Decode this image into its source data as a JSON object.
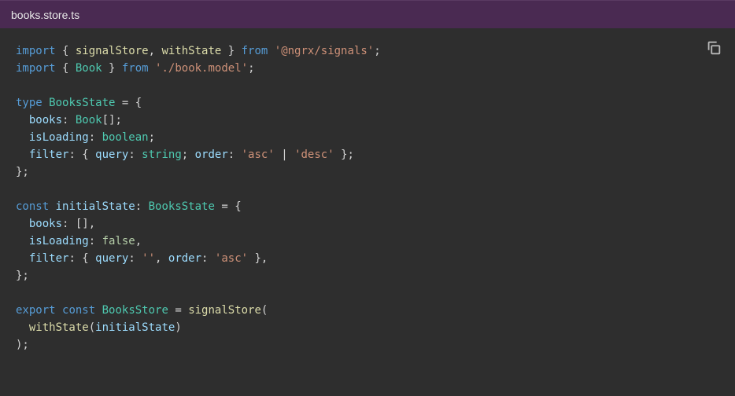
{
  "file": {
    "name": "books.store.ts"
  },
  "copy": {
    "label": "Copy"
  },
  "code": {
    "tokens": [
      [
        [
          "key",
          "import"
        ],
        [
          "punc",
          " { "
        ],
        [
          "fn",
          "signalStore"
        ],
        [
          "punc",
          ", "
        ],
        [
          "fn",
          "withState"
        ],
        [
          "punc",
          " } "
        ],
        [
          "key",
          "from"
        ],
        [
          "punc",
          " "
        ],
        [
          "str",
          "'@ngrx/signals'"
        ],
        [
          "punc",
          ";"
        ]
      ],
      [
        [
          "key",
          "import"
        ],
        [
          "punc",
          " { "
        ],
        [
          "type",
          "Book"
        ],
        [
          "punc",
          " } "
        ],
        [
          "key",
          "from"
        ],
        [
          "punc",
          " "
        ],
        [
          "str",
          "'./book.model'"
        ],
        [
          "punc",
          ";"
        ]
      ],
      [],
      [
        [
          "key",
          "type"
        ],
        [
          "punc",
          " "
        ],
        [
          "type",
          "BooksState"
        ],
        [
          "punc",
          " = {"
        ]
      ],
      [
        [
          "punc",
          "  "
        ],
        [
          "prop",
          "books"
        ],
        [
          "punc",
          ": "
        ],
        [
          "type",
          "Book"
        ],
        [
          "punc",
          "[];"
        ]
      ],
      [
        [
          "punc",
          "  "
        ],
        [
          "prop",
          "isLoading"
        ],
        [
          "punc",
          ": "
        ],
        [
          "type",
          "boolean"
        ],
        [
          "punc",
          ";"
        ]
      ],
      [
        [
          "punc",
          "  "
        ],
        [
          "prop",
          "filter"
        ],
        [
          "punc",
          ": { "
        ],
        [
          "prop",
          "query"
        ],
        [
          "punc",
          ": "
        ],
        [
          "type",
          "string"
        ],
        [
          "punc",
          "; "
        ],
        [
          "prop",
          "order"
        ],
        [
          "punc",
          ": "
        ],
        [
          "str",
          "'asc'"
        ],
        [
          "punc",
          " | "
        ],
        [
          "str",
          "'desc'"
        ],
        [
          "punc",
          " };"
        ]
      ],
      [
        [
          "punc",
          "};"
        ]
      ],
      [],
      [
        [
          "key",
          "const"
        ],
        [
          "punc",
          " "
        ],
        [
          "prop",
          "initialState"
        ],
        [
          "punc",
          ": "
        ],
        [
          "type",
          "BooksState"
        ],
        [
          "punc",
          " = {"
        ]
      ],
      [
        [
          "punc",
          "  "
        ],
        [
          "prop",
          "books"
        ],
        [
          "punc",
          ": [],"
        ]
      ],
      [
        [
          "punc",
          "  "
        ],
        [
          "prop",
          "isLoading"
        ],
        [
          "punc",
          ": "
        ],
        [
          "num",
          "false"
        ],
        [
          "punc",
          ","
        ]
      ],
      [
        [
          "punc",
          "  "
        ],
        [
          "prop",
          "filter"
        ],
        [
          "punc",
          ": { "
        ],
        [
          "prop",
          "query"
        ],
        [
          "punc",
          ": "
        ],
        [
          "str",
          "''"
        ],
        [
          "punc",
          ", "
        ],
        [
          "prop",
          "order"
        ],
        [
          "punc",
          ": "
        ],
        [
          "str",
          "'asc'"
        ],
        [
          "punc",
          " },"
        ]
      ],
      [
        [
          "punc",
          "};"
        ]
      ],
      [],
      [
        [
          "key",
          "export"
        ],
        [
          "punc",
          " "
        ],
        [
          "key",
          "const"
        ],
        [
          "punc",
          " "
        ],
        [
          "type",
          "BooksStore"
        ],
        [
          "punc",
          " = "
        ],
        [
          "fn",
          "signalStore"
        ],
        [
          "punc",
          "("
        ]
      ],
      [
        [
          "punc",
          "  "
        ],
        [
          "fn",
          "withState"
        ],
        [
          "punc",
          "("
        ],
        [
          "prop",
          "initialState"
        ],
        [
          "punc",
          ")"
        ]
      ],
      [
        [
          "punc",
          ");"
        ]
      ]
    ]
  }
}
